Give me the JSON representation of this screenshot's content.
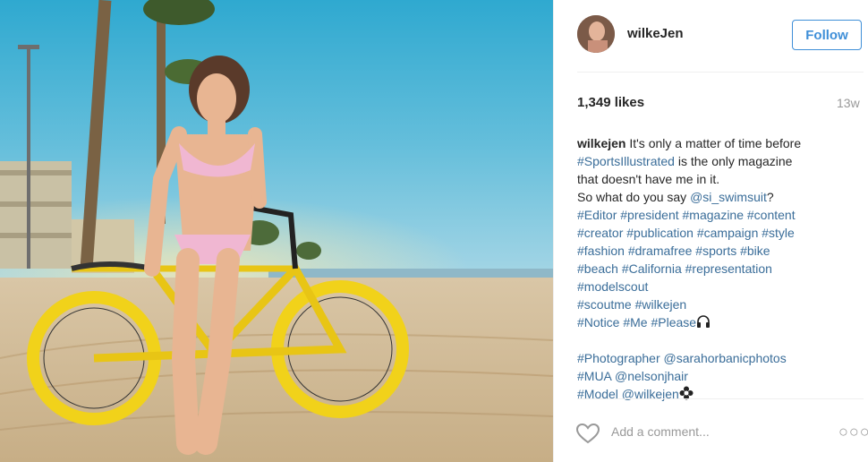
{
  "post": {
    "username": "wilkeJen",
    "follow_label": "Follow",
    "likes": "1,349 likes",
    "time_ago": "13w"
  },
  "caption": {
    "username": "wilkejen",
    "lines": [
      [
        {
          "t": "text",
          "v": " It's only a matter of time before"
        }
      ],
      [
        {
          "t": "tag",
          "v": "#SportsIllustrated"
        },
        {
          "t": "text",
          "v": " is the only magazine"
        }
      ],
      [
        {
          "t": "text",
          "v": "that doesn't have me in it."
        }
      ],
      [
        {
          "t": "text",
          "v": "So what do you say "
        },
        {
          "t": "tag",
          "v": "@si_swimsuit"
        },
        {
          "t": "text",
          "v": "?"
        }
      ],
      [
        {
          "t": "tag",
          "v": "#Editor #president #magazine #content"
        }
      ],
      [
        {
          "t": "tag",
          "v": "#creator #publication #campaign #style"
        }
      ],
      [
        {
          "t": "tag",
          "v": "#fashion #dramafree #sports #bike"
        }
      ],
      [
        {
          "t": "tag",
          "v": "#beach #California #representation"
        }
      ],
      [
        {
          "t": "tag",
          "v": "#modelscout"
        }
      ],
      [
        {
          "t": "tag",
          "v": "#scoutme #wilkejen"
        }
      ],
      [
        {
          "t": "tag",
          "v": "#Notice #Me #Please"
        },
        {
          "t": "emoji",
          "v": "headphones-icon"
        }
      ],
      [],
      [
        {
          "t": "tag",
          "v": "#Photographer @sarahorbanicphotos"
        }
      ],
      [
        {
          "t": "tag",
          "v": "#MUA @nelsonjhair"
        }
      ],
      [
        {
          "t": "tag",
          "v": "#Model @wilkejen"
        },
        {
          "t": "emoji",
          "v": "flower-icon"
        }
      ]
    ]
  },
  "comment": {
    "placeholder": "Add a comment...",
    "more_label": "○○○"
  },
  "icons": [
    "heart-icon",
    "headphones-icon",
    "flower-icon",
    "more-options-icon"
  ],
  "colors": {
    "accent": "#3f8fd8",
    "tag": "#3a6d99",
    "muted": "#999999",
    "text": "#262626"
  }
}
